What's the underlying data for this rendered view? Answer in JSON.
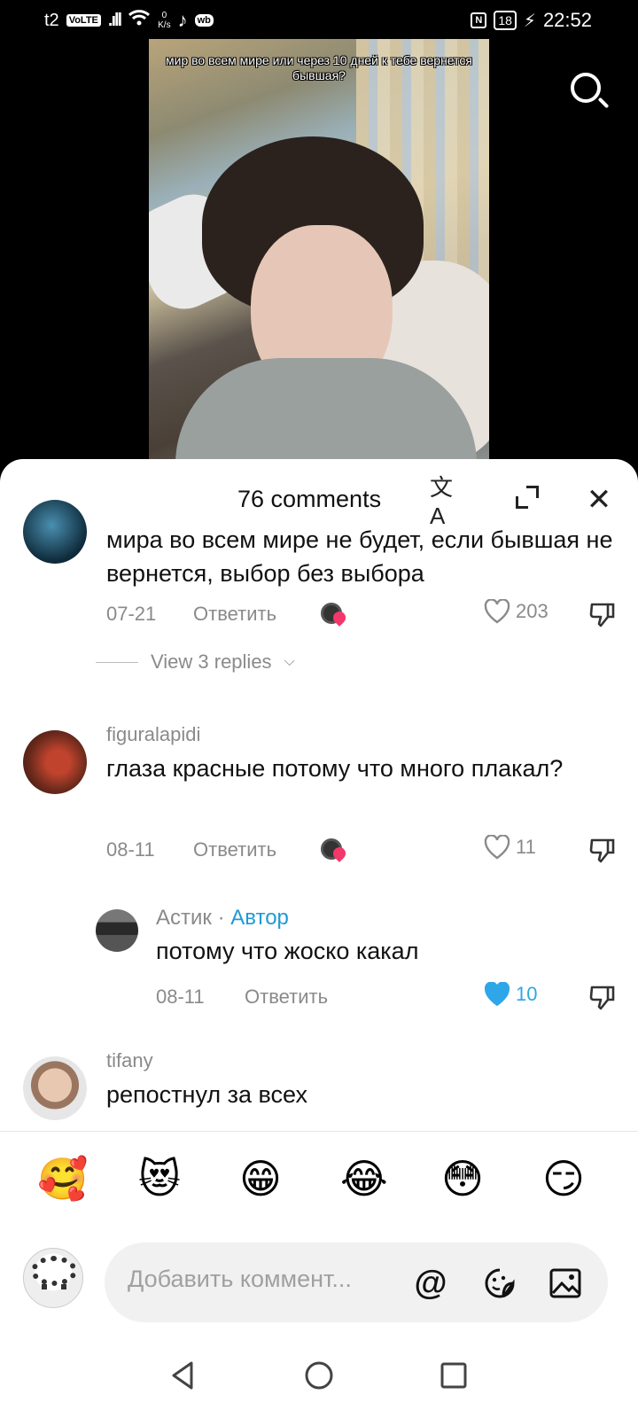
{
  "status_bar": {
    "carrier": "t2",
    "volte": "VoLTE",
    "signal": ".ıll",
    "speed_top": "0",
    "speed_unit": "K/s",
    "wb": "wb",
    "nfc": "N",
    "battery": "18",
    "time": "22:52"
  },
  "video": {
    "caption": "мир во всем мире или через 10 дней к тебе вернется бывшая?"
  },
  "sheet": {
    "comments_count": "76 comments",
    "comments": [
      {
        "username": "",
        "text": "мира во всем мире не будет, если бывшая не вернется, выбор без выбора",
        "date": "07-21",
        "reply_label": "Ответить",
        "likes": "203",
        "liked": false
      },
      {
        "username": "figuralapidi",
        "text": "глаза красные потому что много плакал?",
        "date": "08-11",
        "reply_label": "Ответить",
        "likes": "11",
        "liked": false
      },
      {
        "username": "Астик",
        "separator": " · ",
        "author_tag": "Автор",
        "text": "потому что жоско какал",
        "date": "08-11",
        "reply_label": "Ответить",
        "likes": "10",
        "liked": true
      },
      {
        "username": "tifany",
        "text": "репостнул за всех"
      }
    ],
    "view_replies": "View 3 replies"
  },
  "emoji_bar": [
    "🥰",
    "😻",
    "😁",
    "😂",
    "😳",
    "😏"
  ],
  "input": {
    "placeholder": "Добавить коммент..."
  },
  "colors": {
    "accent": "#1f9ad6",
    "liked_heart": "#2ea6e8",
    "sticker_heart": "#f2376b"
  }
}
